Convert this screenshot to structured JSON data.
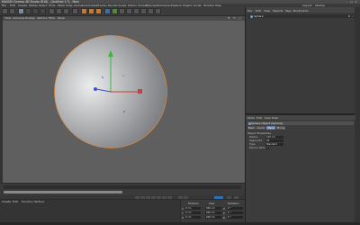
{
  "window": {
    "title": "MAXON Cinema 4D Studio (R18) - [Untitled 1 *] - Main",
    "controls": [
      "–",
      "□",
      "×"
    ]
  },
  "menubar": {
    "items": [
      "File",
      "Edit",
      "Create",
      "Modes",
      "Select",
      "Tools",
      "Mesh",
      "Snap",
      "Animate",
      "Simulate",
      "Tracker",
      "Render",
      "Sculpt",
      "Motion Tracker",
      "MoGraph",
      "Character",
      "Pipeline",
      "Plugins",
      "Script",
      "Window",
      "Help"
    ],
    "layout_label": "Layout:",
    "layout_value": "Startup"
  },
  "viewport": {
    "menu": [
      "View",
      "Cameras",
      "Display",
      "Options",
      "Filter",
      "Panel"
    ],
    "label": "Perspective",
    "background": "#5f5f5f"
  },
  "timeline": {
    "ticks": [
      "0",
      "5",
      "10",
      "15",
      "20",
      "25",
      "30",
      "35",
      "40",
      "45",
      "50",
      "55",
      "60",
      "65",
      "70",
      "75",
      "80",
      "85",
      "90"
    ],
    "start_frame": "0 F",
    "end_frame": "90 F"
  },
  "material_manager": {
    "menu": [
      "Create",
      "Edit",
      "Function",
      "Texture"
    ]
  },
  "coordinates": {
    "headers": [
      "Position",
      "Size",
      "Rotation"
    ],
    "rows": [
      {
        "axis": "X",
        "pos": "0 cm",
        "size": "200 cm",
        "rot_axis": "H",
        "rot": "0 °"
      },
      {
        "axis": "Y",
        "pos": "0 cm",
        "size": "200 cm",
        "rot_axis": "P",
        "rot": "0 °"
      },
      {
        "axis": "Z",
        "pos": "0 cm",
        "size": "200 cm",
        "rot_axis": "B",
        "rot": "0 °"
      }
    ],
    "mode_select": "Object (Rel)",
    "size_select": "Size",
    "apply_label": "Apply"
  },
  "object_manager": {
    "tabs": [
      "File",
      "Edit",
      "View",
      "Objects",
      "Tags",
      "Bookmarks"
    ],
    "objects": [
      {
        "name": "Sphere",
        "enabled_mark": "✓"
      }
    ]
  },
  "attribute_manager": {
    "menu": [
      "Mode",
      "Edit",
      "User Data"
    ],
    "object_header": "Sphere Object [Sphere]",
    "tabs": [
      "Basic",
      "Coord.",
      "Object",
      "Phong"
    ],
    "active_tab": "Object",
    "section": "Object Properties",
    "properties": [
      {
        "label": "Radius",
        "value": "100 cm"
      },
      {
        "label": "Segments",
        "value": "24"
      },
      {
        "label": "Type",
        "value": "Standard"
      },
      {
        "label": "Render Perfect",
        "value": "✓"
      }
    ]
  },
  "colors": {
    "accent_blue": "#5b7aa8",
    "axis_x": "#d23c3c",
    "axis_y": "#3cb43c",
    "axis_z": "#3c50d2",
    "selection_outline": "#e0883a"
  }
}
